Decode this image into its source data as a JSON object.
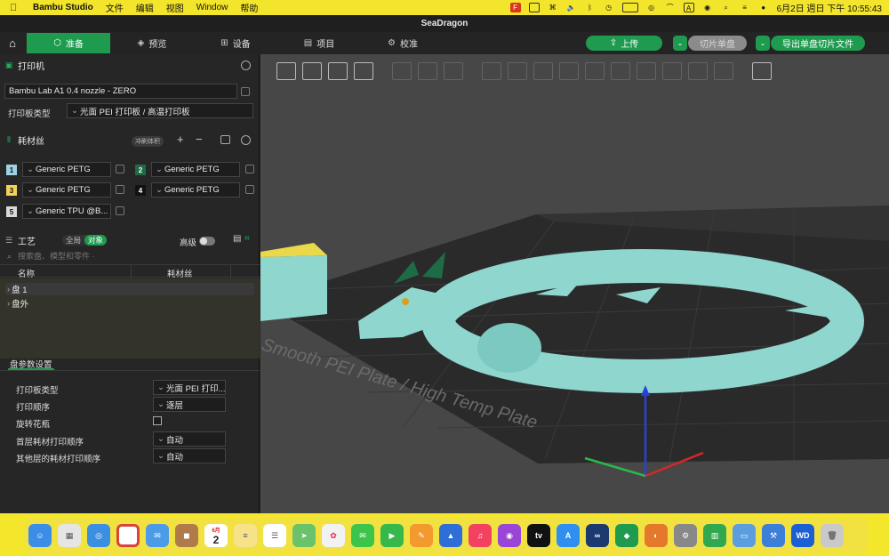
{
  "menubar": {
    "app_name": "Bambu Studio",
    "items": [
      "文件",
      "编辑",
      "视图",
      "Window",
      "帮助"
    ],
    "clock": "6月2日 週日 下午 10:55:43"
  },
  "window": {
    "title": "SeaDragon"
  },
  "toolbar": {
    "tabs": [
      {
        "label": "准备",
        "icon": "cube-icon"
      },
      {
        "label": "预览",
        "icon": "layers-icon"
      },
      {
        "label": "设备",
        "icon": "device-icon"
      },
      {
        "label": "项目",
        "icon": "project-icon"
      },
      {
        "label": "校准",
        "icon": "calibrate-icon"
      }
    ],
    "upload_label": "上传",
    "slice_label": "切片单盘",
    "export_label": "导出单盘切片文件"
  },
  "printer": {
    "section_title": "打印机",
    "printer_name": "Bambu Lab A1 0.4 nozzle - ZERO",
    "plate_type_label": "打印板类型",
    "plate_type_value": "光面 PEI 打印板 / 高温打印板"
  },
  "filament": {
    "section_title": "耗材丝",
    "flush_label": "冲刷体积",
    "slots": [
      {
        "num": "1",
        "name": "Generic PETG",
        "color": "#9ed0e6"
      },
      {
        "num": "2",
        "name": "Generic PETG",
        "color": "#1e6b45"
      },
      {
        "num": "3",
        "name": "Generic PETG",
        "color": "#f2d25a"
      },
      {
        "num": "4",
        "name": "Generic PETG",
        "color": "#111111"
      },
      {
        "num": "5",
        "name": "Generic TPU @B...",
        "color": "#d8d8d8"
      }
    ]
  },
  "process": {
    "section_title": "工艺",
    "seg_global": "全局",
    "seg_object": "对象",
    "advanced_label": "高级",
    "search_placeholder": "搜索盘、模型和零件 ·",
    "col_name": "名称",
    "col_filament": "耗材丝",
    "tree": [
      "盘 1",
      "盘外"
    ]
  },
  "plate_params": {
    "section_title": "盘参数设置",
    "rows": [
      {
        "label": "打印板类型",
        "value": "光面 PEI 打印..."
      },
      {
        "label": "打印顺序",
        "value": "逐层"
      },
      {
        "label": "旋转花瓶",
        "value": ""
      },
      {
        "label": "首层耗材打印顺序",
        "value": "自动"
      },
      {
        "label": "其他层的耗材打印顺序",
        "value": "自动"
      }
    ]
  },
  "viewport": {
    "plate_text": "Smooth PEI Plate / High Temp Plate"
  },
  "dock": {
    "calendar_month": "6月",
    "calendar_day": "2",
    "apps": [
      "finder",
      "launchpad",
      "safari",
      "chrome",
      "mail",
      "contacts",
      "calendar",
      "notes",
      "reminders",
      "maps",
      "photos",
      "messages",
      "facetime",
      "pages",
      "keynote",
      "music",
      "podcasts",
      "tv",
      "appstore",
      "infinity",
      "bambu",
      "blender",
      "preferences",
      "numbers",
      "preview",
      "xcode",
      "wd",
      "trash"
    ]
  }
}
